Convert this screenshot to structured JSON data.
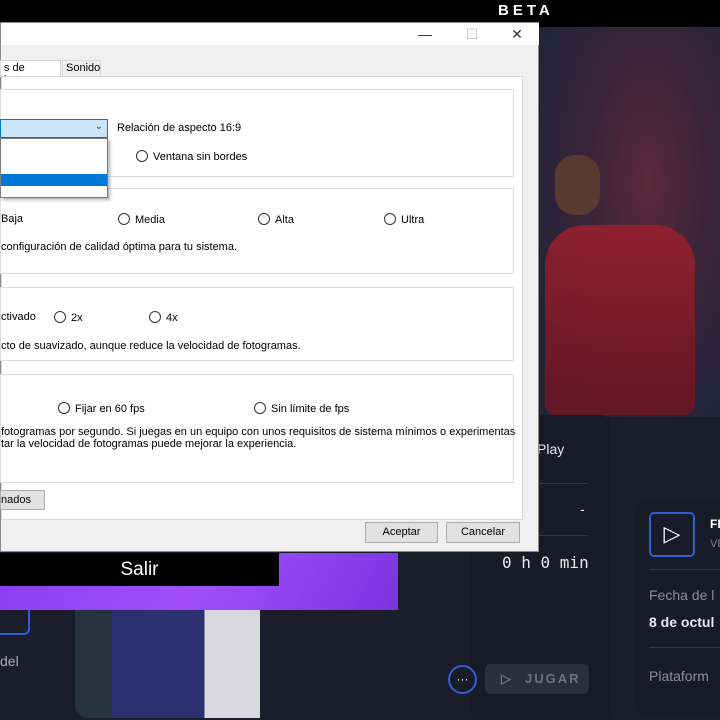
{
  "top": {
    "badge": "BETA"
  },
  "dialog": {
    "controls": {
      "minimize": "—",
      "maximize": "☐",
      "close": "✕"
    },
    "tabs": [
      "s de botones",
      "Sonido"
    ],
    "display": {
      "aspect_label": "Relación de aspecto 16:9",
      "borderless": "Ventana sin bordes"
    },
    "quality": {
      "options": [
        "Baja",
        "Media",
        "Alta",
        "Ultra"
      ],
      "desc": "configuración de calidad óptima para tu sistema."
    },
    "aa": {
      "options": [
        "ctivado",
        "2x",
        "4x"
      ],
      "desc": "cto de suavizado, aunque reduce la velocidad de fotogramas."
    },
    "fps": {
      "options": [
        "Fijar en 60 fps",
        "Sin límite de fps"
      ],
      "desc1": "fotogramas por segundo. Si juegas en un equipo con unos requisitos de sistema mínimos o experimentas",
      "desc2": "tar la velocidad de fotogramas puede mejorar la experiencia."
    },
    "advanced_label": "nados",
    "ok": "Aceptar",
    "cancel": "Cancelar"
  },
  "launcher": {
    "exit": "Salir",
    "play_partial": "Play",
    "dash": "-",
    "time": "0 h 0 min",
    "del_partial": "del",
    "play_button": "JUGAR",
    "more_icon": "···",
    "game_title_partial": "FI",
    "game_sub_partial": "VE",
    "release_label": "Fecha de l",
    "release_value": "8 de octul",
    "platform_label": "Plataform",
    "accent": "#2f5fd0"
  }
}
